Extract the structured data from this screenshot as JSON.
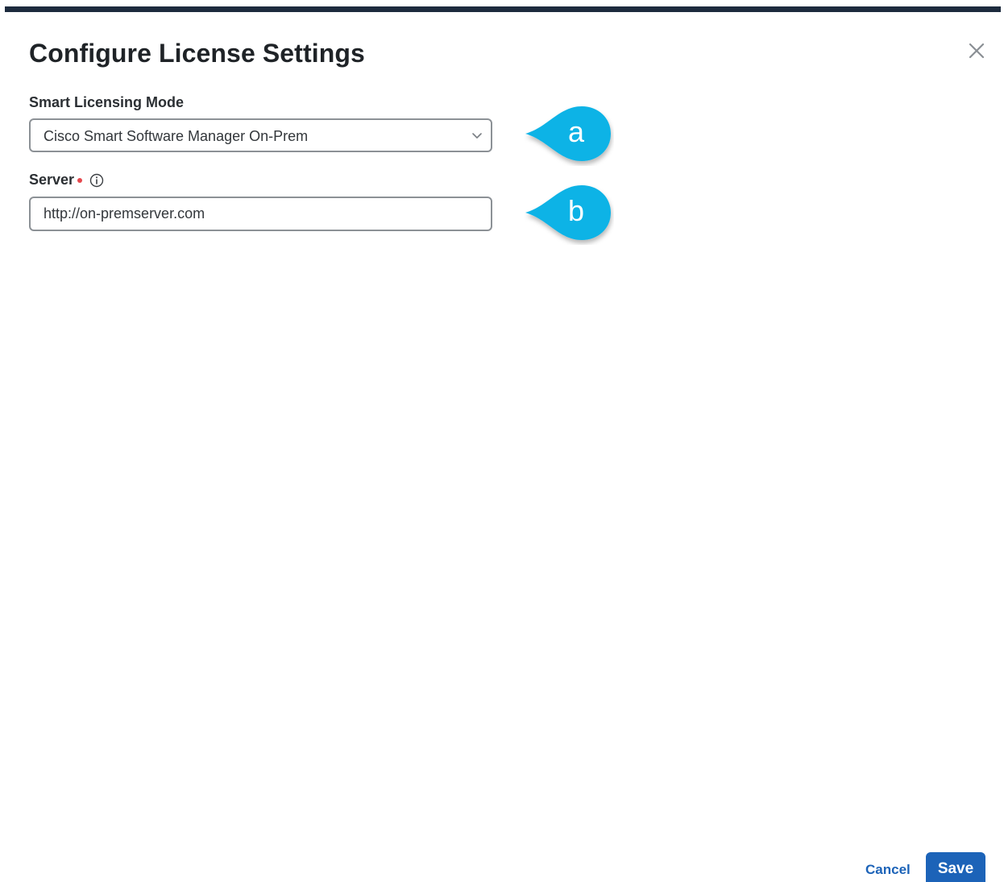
{
  "dialog": {
    "title": "Configure License Settings",
    "close_icon": "close-icon"
  },
  "fields": {
    "mode": {
      "label": "Smart Licensing Mode",
      "selected_value": "Cisco Smart Software Manager On-Prem",
      "icon": "chevron-down-icon"
    },
    "server": {
      "label": "Server",
      "required": true,
      "info_icon": "info-icon",
      "value": "http://on-premserver.com"
    }
  },
  "callouts": {
    "a": "a",
    "b": "b"
  },
  "footer": {
    "cancel_label": "Cancel",
    "save_label": "Save"
  },
  "colors": {
    "primary": "#1c63b8",
    "callout": "#10b3e6",
    "top_bar": "#1d2b3e",
    "required": "#e5484d"
  }
}
